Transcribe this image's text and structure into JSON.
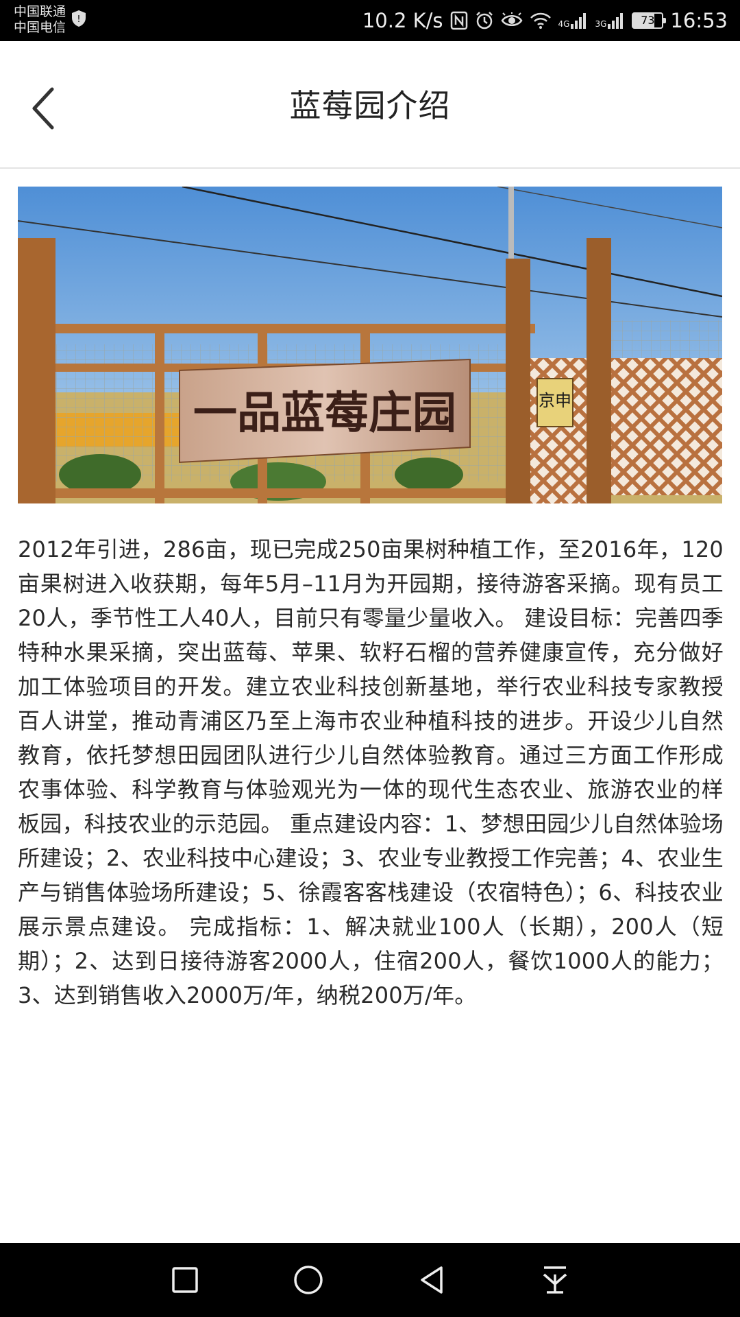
{
  "status_bar": {
    "carrier_1": "中国联通",
    "carrier_2": "中国电信",
    "net_speed": "10.2 K/s",
    "signal_1_tag": "4G",
    "signal_2_tag": "3G",
    "battery_level": "73",
    "time": "16:53"
  },
  "header": {
    "title": "蓝莓园介绍"
  },
  "hero": {
    "sign_text": "一品蓝莓庄园",
    "side_sign_text": "京申"
  },
  "content": {
    "intro": "2012年引进，286亩，现已完成250亩果树种植工作，至2016年，120亩果树进入收获期，每年5月–11月为开园期，接待游客采摘。现有员工20人，季节性工人40人，目前只有零量少量收入。 建设目标：完善四季特种水果采摘，突出蓝莓、苹果、软籽石榴的营养健康宣传，充分做好加工体验项目的开发。建立农业科技创新基地，举行农业科技专家教授百人讲堂，推动青浦区乃至上海市农业种植科技的进步。开设少儿自然教育，依托梦想田园团队进行少儿自然体验教育。通过三方面工作形成农事体验、科学教育与体验观光为一体的现代生态农业、旅游农业的样板园，科技农业的示范园。 重点建设内容：1、梦想田园少儿自然体验场所建设；2、农业科技中心建设；3、农业专业教授工作完善；4、农业生产与销售体验场所建设；5、徐霞客客栈建设（农宿特色）；6、科技农业展示景点建设。 完成指标：1、解决就业100人（长期），200人（短期）；2、达到日接待游客2000人，住宿200人，餐饮1000人的能力；3、达到销售收入2000万/年，纳税200万/年。"
  },
  "nav_bar": {
    "icons": [
      "square-icon",
      "circle-icon",
      "triangle-back-icon",
      "pull-down-icon"
    ]
  }
}
